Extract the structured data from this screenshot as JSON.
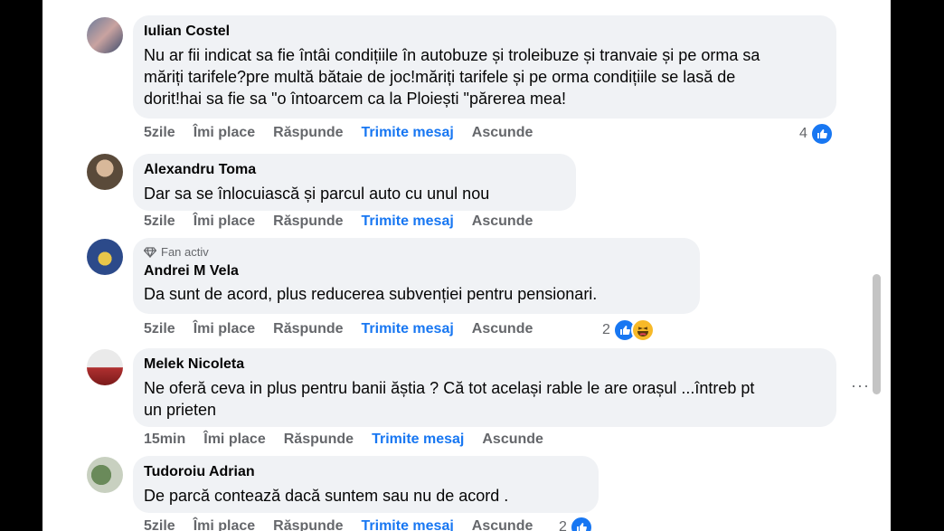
{
  "comments": [
    {
      "author": "Iulian Costel",
      "lines": [
        "Nu ar fii indicat sa fie întâi condițiile în autobuze și troleibuze și tranvaie și pe orma sa",
        "măriți tarifele?pre multă bătaie de joc!măriți tarifele și pe orma condițiile se lasă de",
        "dorit!hai sa fie sa \"o întoarcem ca la Ploiești \"părerea mea!"
      ],
      "time": "5zile",
      "like": "Îmi place",
      "reply": "Răspunde",
      "message": "Trimite mesaj",
      "hide": "Ascunde",
      "reaction_count": "4"
    },
    {
      "author": "Alexandru Toma",
      "lines": [
        "Dar sa se înlocuiască și parcul auto cu unul nou"
      ],
      "time": "5zile",
      "like": "Îmi place",
      "reply": "Răspunde",
      "message": "Trimite mesaj",
      "hide": "Ascunde"
    },
    {
      "badge": "Fan activ",
      "author": "Andrei M Vela",
      "lines": [
        "Da sunt de acord, plus reducerea subvenției pentru pensionari."
      ],
      "time": "5zile",
      "like": "Îmi place",
      "reply": "Răspunde",
      "message": "Trimite mesaj",
      "hide": "Ascunde",
      "reaction_count": "2"
    },
    {
      "author": "Melek Nicoleta",
      "lines": [
        "Ne oferă ceva in plus pentru banii ăștia ? Că tot același rable le are orașul ...întreb pt",
        "un prieten"
      ],
      "time": "15min",
      "like": "Îmi place",
      "reply": "Răspunde",
      "message": "Trimite mesaj",
      "hide": "Ascunde",
      "more": "···"
    },
    {
      "author": "Tudoroiu Adrian",
      "lines": [
        "De parcă contează dacă suntem sau nu de acord ."
      ],
      "time": "5zile",
      "like": "Îmi place",
      "reply": "Răspunde",
      "message": "Trimite mesaj",
      "hide": "Ascunde",
      "reaction_count": "2"
    }
  ],
  "icons": {
    "like": "like-icon",
    "haha": "haha-icon",
    "badge": "diamond-icon",
    "more": "more-options-icon"
  },
  "colors": {
    "accent": "#1877f2",
    "bubble": "#f0f2f5",
    "muted": "#65676b"
  }
}
